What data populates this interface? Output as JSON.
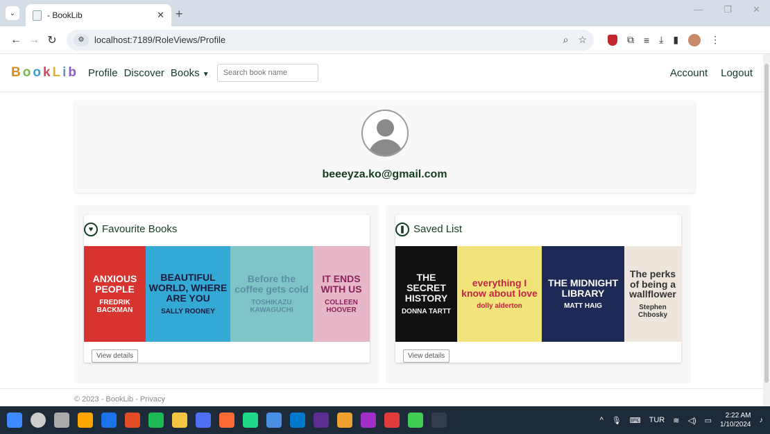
{
  "browser": {
    "tab_title": " - BookLib",
    "url": "localhost:7189/RoleViews/Profile"
  },
  "app": {
    "brand_letters": [
      "B",
      "o",
      "o",
      "k",
      "L",
      "i",
      "b"
    ],
    "nav": {
      "profile": "Profile",
      "discover": "Discover",
      "books": "Books"
    },
    "search_placeholder": "Search book name",
    "account": "Account",
    "logout": "Logout"
  },
  "profile": {
    "email": "beeeyza.ko@gmail.com"
  },
  "favourites": {
    "title": "Favourite Books",
    "view_details": "View details",
    "covers": [
      {
        "title": "ANXIOUS PEOPLE",
        "author": "FREDRIK BACKMAN",
        "bg": "#d8342f",
        "fg": "#ffffff"
      },
      {
        "title": "BEAUTIFUL WORLD, WHERE ARE YOU",
        "author": "SALLY ROONEY",
        "bg": "#35a9d5",
        "fg": "#1a1a3a"
      },
      {
        "title": "Before the coffee gets cold",
        "author": "TOSHIKAZU KAWAGUCHI",
        "bg": "#7fc4c6",
        "fg": "#5b8ea3"
      },
      {
        "title": "IT ENDS WITH US",
        "author": "COLLEEN HOOVER",
        "bg": "#e5b7c8",
        "fg": "#8b2259"
      }
    ]
  },
  "saved": {
    "title": "Saved List",
    "view_details": "View details",
    "covers": [
      {
        "title": "THE SECRET HISTORY",
        "author": "DONNA TARTT",
        "bg": "#111111",
        "fg": "#f1f1f1"
      },
      {
        "title": "everything I know about love",
        "author": "dolly alderton",
        "bg": "#f1e47a",
        "fg": "#c2263f"
      },
      {
        "title": "THE MIDNIGHT LIBRARY",
        "author": "MATT HAIG",
        "bg": "#1d2a55",
        "fg": "#ffffff"
      },
      {
        "title": "The perks of being a wallflower",
        "author": "Stephen Chbosky",
        "bg": "#eee6dc",
        "fg": "#333333"
      }
    ]
  },
  "footer": {
    "text": "© 2023 - BookLib - Privacy"
  },
  "taskbar": {
    "lang": "TUR",
    "time": "2:22 AM",
    "date": "1/10/2024",
    "icon_colors": [
      "#3d8bff",
      "#cccccc",
      "#aaaaaa",
      "#ffa500",
      "#1a73e8",
      "#e34c26",
      "#1db954",
      "#f5c542",
      "#4f6ff5",
      "#ff6b35",
      "#21d789",
      "#4a90e2",
      "#007acc",
      "#5c2d91",
      "#f0a030",
      "#a12fc9",
      "#e23b3b",
      "#41cd52",
      "#333c4a"
    ]
  }
}
